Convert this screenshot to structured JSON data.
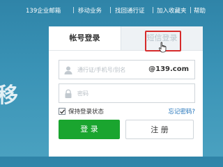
{
  "colors": {
    "background": "#3a93b6",
    "login_button": "#1aa52f",
    "highlight": "#d62b2b",
    "link": "#1b6fb8"
  },
  "topnav": {
    "links": [
      "139企业邮箱",
      "移动业务",
      "找回通行证",
      "加入收藏夹",
      "帮助"
    ]
  },
  "background_glyph": "移",
  "login_panel": {
    "tabs": {
      "account_login": "帐号登录",
      "sms_login": "短信登录"
    },
    "username": {
      "placeholder": "通行证/手机号/别名",
      "suffix": "@139.com",
      "icon": "user-icon"
    },
    "password": {
      "placeholder": "密码",
      "icon": "lock-icon"
    },
    "remember_label": "保持登录状态",
    "remember_checked": true,
    "forgot_link": "忘记密码?",
    "login_button": "登 录",
    "register_button": "注 册"
  }
}
